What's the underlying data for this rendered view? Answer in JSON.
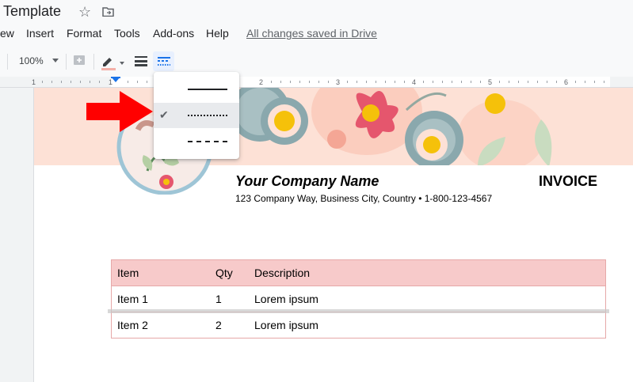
{
  "doc": {
    "title": "Template",
    "saved_status": "All changes saved in Drive"
  },
  "menu": {
    "items": [
      "ew",
      "Insert",
      "Format",
      "Tools",
      "Add-ons",
      "Help"
    ]
  },
  "toolbar": {
    "zoom": "100%"
  },
  "ruler": {
    "numbers": [
      "1",
      "1",
      "2",
      "3",
      "4",
      "5",
      "6"
    ]
  },
  "border_dash_dropdown": {
    "options": [
      "solid",
      "dotted",
      "dashed"
    ],
    "selected": "dotted"
  },
  "invoice": {
    "company_name": "Your Company Name",
    "label": "INVOICE",
    "address": "123 Company Way, Business City, Country • 1-800-123-4567",
    "table": {
      "headers": [
        "Item",
        "Qty",
        "Description"
      ],
      "rows": [
        [
          "Item 1",
          "1",
          "Lorem ipsum"
        ],
        [
          "Item 2",
          "2",
          "Lorem ipsum"
        ]
      ]
    }
  },
  "colors": {
    "accent_blue": "#1a73e8",
    "arrow_red": "#ff0000",
    "table_header_bg": "#f7caca",
    "banner_bg": "#fde1d6"
  }
}
